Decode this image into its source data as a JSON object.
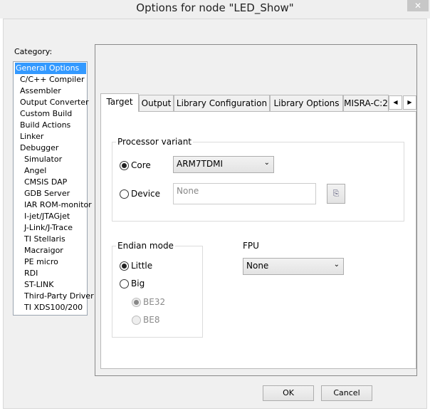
{
  "window": {
    "title": "Options for node \"LED_Show\"",
    "close": "✕"
  },
  "category": {
    "label": "Category:",
    "items": [
      {
        "label": "General Options",
        "indent": 0,
        "selected": true
      },
      {
        "label": "C/C++ Compiler",
        "indent": 1
      },
      {
        "label": "Assembler",
        "indent": 1
      },
      {
        "label": "Output Converter",
        "indent": 1
      },
      {
        "label": "Custom Build",
        "indent": 1
      },
      {
        "label": "Build Actions",
        "indent": 1
      },
      {
        "label": "Linker",
        "indent": 1
      },
      {
        "label": "Debugger",
        "indent": 1
      },
      {
        "label": "Simulator",
        "indent": 2
      },
      {
        "label": "Angel",
        "indent": 2
      },
      {
        "label": "CMSIS DAP",
        "indent": 2
      },
      {
        "label": "GDB Server",
        "indent": 2
      },
      {
        "label": "IAR ROM-monitor",
        "indent": 2
      },
      {
        "label": "I-jet/JTAGjet",
        "indent": 2
      },
      {
        "label": "J-Link/J-Trace",
        "indent": 2
      },
      {
        "label": "TI Stellaris",
        "indent": 2
      },
      {
        "label": "Macraigor",
        "indent": 2
      },
      {
        "label": "PE micro",
        "indent": 2
      },
      {
        "label": "RDI",
        "indent": 2
      },
      {
        "label": "ST-LINK",
        "indent": 2
      },
      {
        "label": "Third-Party Driver",
        "indent": 2
      },
      {
        "label": "TI XDS100/200",
        "indent": 2
      }
    ]
  },
  "tabs": [
    {
      "label": "Target",
      "active": true
    },
    {
      "label": "Output"
    },
    {
      "label": "Library Configuration"
    },
    {
      "label": "Library Options"
    },
    {
      "label": "MISRA-C:2"
    }
  ],
  "tab_scroll": {
    "left": "◀",
    "right": "▶"
  },
  "processor": {
    "group_label": "Processor variant",
    "core_label": "Core",
    "core_value": "ARM7TDMI",
    "device_label": "Device",
    "device_value": "None",
    "selected": "Core"
  },
  "endian": {
    "group_label": "Endian mode",
    "little": "Little",
    "big": "Big",
    "be32": "BE32",
    "be8": "BE8",
    "selected": "Little"
  },
  "fpu": {
    "label": "FPU",
    "value": "None"
  },
  "buttons": {
    "ok": "OK",
    "cancel": "Cancel"
  }
}
